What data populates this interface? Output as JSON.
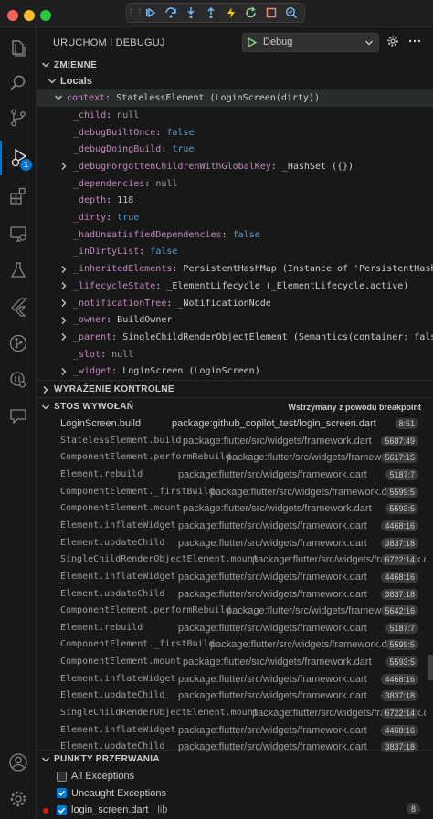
{
  "toolbar_icons": [
    "grip-icon",
    "continue-icon",
    "step-over-icon",
    "step-into-icon",
    "step-out-icon",
    "hot-reload-icon",
    "restart-icon",
    "stop-icon",
    "inspect-widget-icon"
  ],
  "activity_icons": [
    "explorer-icon",
    "search-icon",
    "source-control-icon",
    "run-debug-icon",
    "extensions-icon",
    "remote-explorer-icon",
    "testing-icon",
    "flutter-icon",
    "git-graph-icon",
    "copilot-icon",
    "chat-icon"
  ],
  "activity_badge": "1",
  "accent_color": "#0078d4",
  "sidebar": {
    "title": "URUCHOM I DEBUGUJ",
    "config_label": "Debug"
  },
  "variables": {
    "header": "ZMIENNE",
    "scope": "Locals",
    "context_name": "context",
    "context_value": "StatelessElement (LoginScreen(dirty))",
    "items": [
      {
        "name": "_child",
        "value": "null",
        "kind": "null",
        "expandable": false
      },
      {
        "name": "_debugBuiltOnce",
        "value": "false",
        "kind": "bool",
        "expandable": false
      },
      {
        "name": "_debugDoingBuild",
        "value": "true",
        "kind": "bool",
        "expandable": false
      },
      {
        "name": "_debugForgottenChildrenWithGlobalKey",
        "value": "_HashSet ({})",
        "kind": "obj",
        "expandable": true
      },
      {
        "name": "_dependencies",
        "value": "null",
        "kind": "null",
        "expandable": false
      },
      {
        "name": "_depth",
        "value": "118",
        "kind": "num",
        "expandable": false
      },
      {
        "name": "_dirty",
        "value": "true",
        "kind": "bool",
        "expandable": false
      },
      {
        "name": "_hadUnsatisfiedDependencies",
        "value": "false",
        "kind": "bool",
        "expandable": false
      },
      {
        "name": "_inDirtyList",
        "value": "false",
        "kind": "bool",
        "expandable": false
      },
      {
        "name": "_inheritedElements",
        "value": "PersistentHashMap (Instance of 'PersistentHashMap<Type, InheritedElement>')",
        "kind": "obj",
        "expandable": true
      },
      {
        "name": "_lifecycleState",
        "value": "_ElementLifecycle (_ElementLifecycle.active)",
        "kind": "obj",
        "expandable": true
      },
      {
        "name": "_notificationTree",
        "value": "_NotificationNode",
        "kind": "obj",
        "expandable": true
      },
      {
        "name": "_owner",
        "value": "BuildOwner",
        "kind": "obj",
        "expandable": true
      },
      {
        "name": "_parent",
        "value": "SingleChildRenderObjectElement (Semantics(container: false, properties: SemanticsProperties))",
        "kind": "obj",
        "expandable": true
      },
      {
        "name": "_slot",
        "value": "null",
        "kind": "null",
        "expandable": false
      },
      {
        "name": "_widget",
        "value": "LoginScreen (LoginScreen)",
        "kind": "obj",
        "expandable": true
      }
    ]
  },
  "watch": {
    "header": "WYRAŻENIE KONTROLNE"
  },
  "callstack": {
    "header": "STOS WYWOŁAŃ",
    "status": "Wstrzymany z powodu breakpoint",
    "frames": [
      {
        "fn": "LoginScreen.build",
        "src": "package:github_copilot_test/login_screen.dart",
        "pos": "8:51"
      },
      {
        "fn": "StatelessElement.build",
        "src": "package:flutter/src/widgets/framework.dart",
        "pos": "5687:49"
      },
      {
        "fn": "ComponentElement.performRebuild",
        "src": "package:flutter/src/widgets/framework.dart",
        "pos": "5617:15"
      },
      {
        "fn": "Element.rebuild",
        "src": "package:flutter/src/widgets/framework.dart",
        "pos": "5187:7"
      },
      {
        "fn": "ComponentElement._firstBuild",
        "src": "package:flutter/src/widgets/framework.dart",
        "pos": "5599:5"
      },
      {
        "fn": "ComponentElement.mount",
        "src": "package:flutter/src/widgets/framework.dart",
        "pos": "5593:5"
      },
      {
        "fn": "Element.inflateWidget",
        "src": "package:flutter/src/widgets/framework.dart",
        "pos": "4468:16"
      },
      {
        "fn": "Element.updateChild",
        "src": "package:flutter/src/widgets/framework.dart",
        "pos": "3837:18"
      },
      {
        "fn": "SingleChildRenderObjectElement.mount",
        "src": "package:flutter/src/widgets/framework.dart",
        "pos": "6722:14"
      },
      {
        "fn": "Element.inflateWidget",
        "src": "package:flutter/src/widgets/framework.dart",
        "pos": "4468:16"
      },
      {
        "fn": "Element.updateChild",
        "src": "package:flutter/src/widgets/framework.dart",
        "pos": "3837:18"
      },
      {
        "fn": "ComponentElement.performRebuild",
        "src": "package:flutter/src/widgets/framework.dart",
        "pos": "5642:16"
      },
      {
        "fn": "Element.rebuild",
        "src": "package:flutter/src/widgets/framework.dart",
        "pos": "5187:7"
      },
      {
        "fn": "ComponentElement._firstBuild",
        "src": "package:flutter/src/widgets/framework.dart",
        "pos": "5599:5"
      },
      {
        "fn": "ComponentElement.mount",
        "src": "package:flutter/src/widgets/framework.dart",
        "pos": "5593:5"
      },
      {
        "fn": "Element.inflateWidget",
        "src": "package:flutter/src/widgets/framework.dart",
        "pos": "4468:16"
      },
      {
        "fn": "Element.updateChild",
        "src": "package:flutter/src/widgets/framework.dart",
        "pos": "3837:18"
      },
      {
        "fn": "SingleChildRenderObjectElement.mount",
        "src": "package:flutter/src/widgets/framework.dart",
        "pos": "6722:14"
      },
      {
        "fn": "Element.inflateWidget",
        "src": "package:flutter/src/widgets/framework.dart",
        "pos": "4468:16"
      },
      {
        "fn": "Element.updateChild",
        "src": "package:flutter/src/widgets/framework.dart",
        "pos": "3837:18"
      }
    ]
  },
  "breakpoints": {
    "header": "PUNKTY PRZERWANIA",
    "items": [
      {
        "label": "All Exceptions",
        "checked": false
      },
      {
        "label": "Uncaught Exceptions",
        "checked": true
      },
      {
        "label": "login_screen.dart",
        "checked": true,
        "dir": "lib",
        "count": "8"
      }
    ]
  }
}
